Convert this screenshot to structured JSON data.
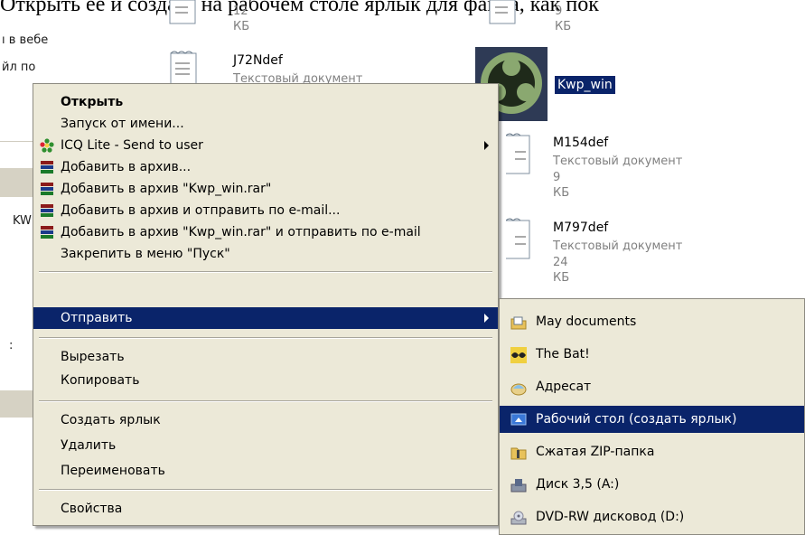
{
  "caption": "Открыть ее и создать на рабочем столе ярлык для файла, как пок",
  "left_panel": {
    "line1": "ı в вебе",
    "line2": "йл по",
    "fragment_kw": "KW",
    "fragment_colon": ":"
  },
  "files": [
    {
      "name": "",
      "meta1": "12 КБ",
      "meta2": ""
    },
    {
      "name": "",
      "meta1": "9 КБ",
      "meta2": ""
    },
    {
      "name": "J72Ndef",
      "meta1": "Текстовый документ",
      "meta2": ""
    },
    {
      "name": "Kwp_win",
      "meta1": "",
      "meta2": ""
    },
    {
      "name": "M154def",
      "meta1": "Текстовый документ",
      "meta2": "9 КБ"
    },
    {
      "name": "M797def",
      "meta1": "Текстовый документ",
      "meta2": "24 КБ"
    }
  ],
  "context_menu": {
    "items": [
      {
        "label": "Открыть",
        "icon": ""
      },
      {
        "label": "Запуск от имени...",
        "icon": ""
      },
      {
        "label": "ICQ Lite - Send to user",
        "icon": "icq-flower-icon"
      },
      {
        "label": "Добавить в архив...",
        "icon": "winrar-books-icon"
      },
      {
        "label": "Добавить в архив \"Kwp_win.rar\"",
        "icon": "winrar-books-icon"
      },
      {
        "label": "Добавить в архив и отправить по e-mail...",
        "icon": "winrar-books-icon"
      },
      {
        "label": "Добавить в архив \"Kwp_win.rar\" и отправить по e-mail",
        "icon": "winrar-books-icon"
      },
      {
        "label": "Закрепить в меню \"Пуск\"",
        "icon": ""
      },
      {
        "label": "Отправить",
        "icon": ""
      },
      {
        "label": "Вырезать",
        "icon": ""
      },
      {
        "label": "Копировать",
        "icon": ""
      },
      {
        "label": "Создать ярлык",
        "icon": ""
      },
      {
        "label": "Удалить",
        "icon": ""
      },
      {
        "label": "Переименовать",
        "icon": ""
      },
      {
        "label": "Свойства",
        "icon": ""
      }
    ]
  },
  "send_to_menu": {
    "items": [
      {
        "label": "May documents",
        "icon": "folder-documents-icon"
      },
      {
        "label": "The Bat!",
        "icon": "the-bat-icon"
      },
      {
        "label": "Адресат",
        "icon": "mail-recipient-icon"
      },
      {
        "label": "Рабочий стол (создать ярлык)",
        "icon": "desktop-shortcut-icon"
      },
      {
        "label": "Сжатая ZIP-папка",
        "icon": "zip-folder-icon"
      },
      {
        "label": "Диск 3,5 (A:)",
        "icon": "floppy-drive-icon"
      },
      {
        "label": "DVD-RW дисковод (D:)",
        "icon": "dvd-drive-icon"
      }
    ]
  },
  "colors": {
    "menu_bg": "#ece9d8",
    "selection": "#0a246a",
    "selection_text": "#ffffff",
    "meta_text": "#808080"
  }
}
